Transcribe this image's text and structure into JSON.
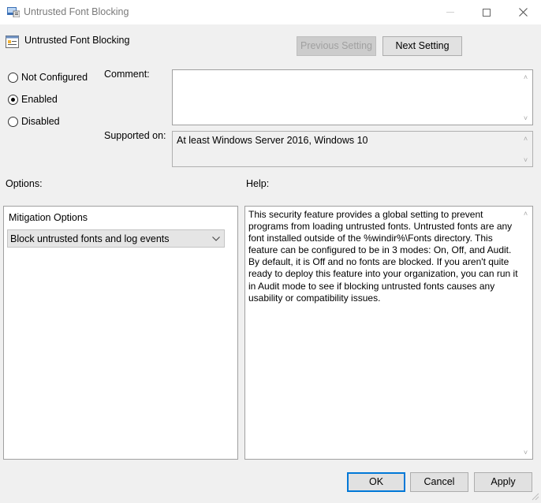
{
  "window": {
    "title": "Untrusted Font Blocking",
    "minimize_icon": "minimize-icon",
    "maximize_icon": "maximize-icon",
    "close_icon": "close-icon"
  },
  "header": {
    "policy_name": "Untrusted Font Blocking",
    "prev_label": "Previous Setting",
    "next_label": "Next Setting"
  },
  "state": {
    "options": [
      {
        "label": "Not Configured",
        "selected": false
      },
      {
        "label": "Enabled",
        "selected": true
      },
      {
        "label": "Disabled",
        "selected": false
      }
    ]
  },
  "comment": {
    "label": "Comment:",
    "value": ""
  },
  "supported": {
    "label": "Supported on:",
    "value": "At least Windows Server 2016, Windows 10"
  },
  "options_panel": {
    "heading": "Options:",
    "group_label": "Mitigation Options",
    "dropdown_value": "Block untrusted fonts and log events"
  },
  "help_panel": {
    "heading": "Help:",
    "text": "This security feature provides a global setting to prevent programs from loading untrusted fonts. Untrusted fonts are any font installed outside of the %windir%\\Fonts directory. This feature can be configured to be in 3 modes: On, Off, and Audit. By default, it is Off and no fonts are blocked. If you aren't quite ready to deploy this feature into your organization, you can run it in Audit mode to see if blocking untrusted fonts causes any usability or compatibility issues."
  },
  "footer": {
    "ok_label": "OK",
    "cancel_label": "Cancel",
    "apply_label": "Apply"
  }
}
